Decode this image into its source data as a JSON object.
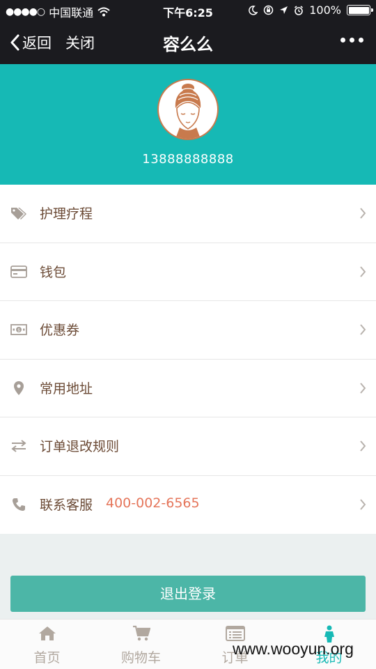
{
  "status_bar": {
    "carrier": "中国联通",
    "time": "下午6:25",
    "battery": "100%"
  },
  "nav": {
    "back_label": "返回",
    "close_label": "关闭",
    "title": "容么么"
  },
  "profile": {
    "phone": "13888888888"
  },
  "menu": {
    "items": [
      {
        "label": "护理疗程",
        "icon": "tag-icon"
      },
      {
        "label": "钱包",
        "icon": "card-icon"
      },
      {
        "label": "优惠券",
        "icon": "coupon-icon"
      },
      {
        "label": "常用地址",
        "icon": "location-pin-icon"
      },
      {
        "label": "订单退改规则",
        "icon": "swap-icon"
      },
      {
        "label": "联系客服",
        "icon": "phone-icon",
        "extra": "400-002-6565"
      }
    ]
  },
  "logout_label": "退出登录",
  "tabbar": {
    "items": [
      {
        "label": "首页",
        "icon": "home-icon"
      },
      {
        "label": "购物车",
        "icon": "cart-icon"
      },
      {
        "label": "订单",
        "icon": "orders-icon"
      },
      {
        "label": "我的",
        "icon": "user-icon",
        "active": true
      }
    ]
  },
  "watermark": "www.wooyun.org",
  "colors": {
    "header_dark": "#1b1b1f",
    "teal": "#16b9b5",
    "logout_button": "#4cb6a7",
    "label_brown": "#6b4a35",
    "hotline": "#e5755a",
    "tab_inactive": "#b1a89f"
  }
}
